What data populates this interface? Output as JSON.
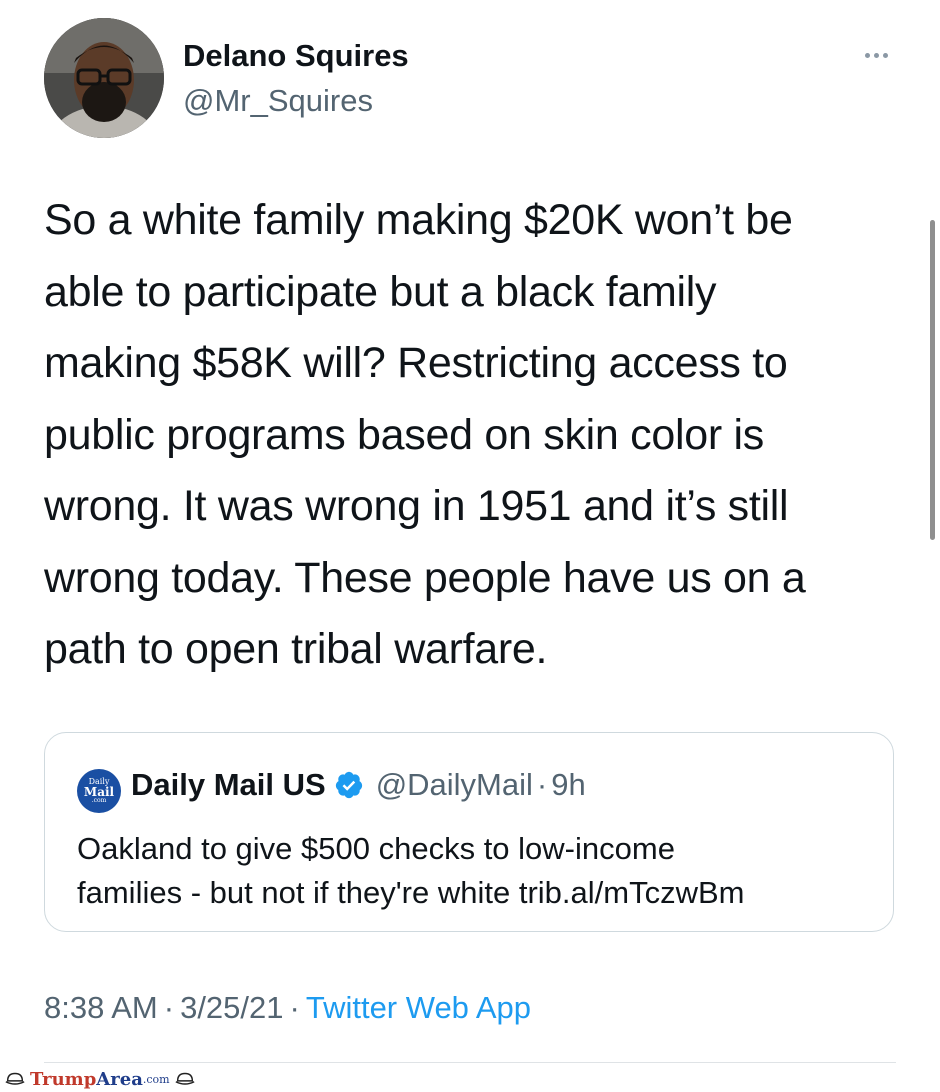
{
  "tweet": {
    "author": {
      "display_name": "Delano Squires",
      "handle": "@Mr_Squires"
    },
    "text_lines": [
      "So a white family making $20K won’t be",
      "able to participate but a black family",
      "making $58K will? Restricting access to",
      "public programs based on skin color is",
      "wrong. It was wrong in 1951 and it’s still",
      "wrong today. These people have us on a",
      "path to open tribal warfare."
    ],
    "time": "8:38 AM",
    "date": "3/25/21",
    "separator": "·",
    "source": "Twitter Web App"
  },
  "quote": {
    "avatar_text": [
      "Daily",
      "Mail",
      ".com"
    ],
    "name": "Daily Mail US",
    "handle": "@DailyMail",
    "separator": "·",
    "time": "9h",
    "text_lines": [
      "Oakland to give $500 checks to low-income",
      "families - but not if they're white trib.al/mTczwBm"
    ]
  },
  "watermark": {
    "part1": "Trump",
    "part2": "Area",
    "part3": ".com"
  },
  "icons": {
    "more": "more-horizontal-icon",
    "verified": "verified-badge-icon"
  },
  "colors": {
    "text": "#0f1419",
    "secondary": "#536471",
    "link": "#1d9bf0",
    "border": "#cfd9de"
  }
}
